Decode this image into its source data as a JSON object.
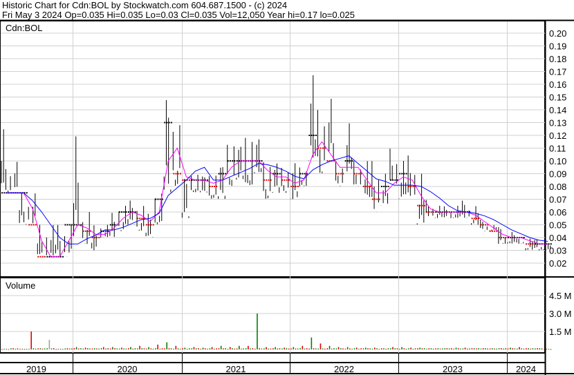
{
  "header": {
    "title": "Historic Chart for Cdn:BOL by Stockwatch.com 604.687.1500 - (c) 2024",
    "quote": "Fri May  3 2024  Op=0.035  Hi=0.035  Lo=0.03  Cl=0.035  Vol=12,050  Year hi=0.17  lo=0.025"
  },
  "chart_data": {
    "type": "line",
    "symbol": "Cdn:BOL",
    "volume_label": "Volume",
    "price_ticks": [
      "0.20",
      "0.19",
      "0.18",
      "0.17",
      "0.16",
      "0.15",
      "0.14",
      "0.13",
      "0.12",
      "0.11",
      "0.10",
      "0.09",
      "0.08",
      "0.07",
      "0.06",
      "0.05",
      "0.04",
      "0.03",
      "0.02"
    ],
    "price_range": [
      0.01,
      0.21
    ],
    "volume_ticks": [
      "4.5 M",
      "3.0 M",
      "1.5 M"
    ],
    "volume_range_m": [
      0,
      5.7
    ],
    "years": [
      "2019",
      "2020",
      "2021",
      "2022",
      "2023",
      "2024"
    ],
    "start_month": "2019-05",
    "high": [
      0.125,
      0.1,
      0.075,
      0.075,
      0.05,
      0.05,
      0.05,
      0.05,
      0.12,
      0.06,
      0.05,
      0.05,
      0.06,
      0.065,
      0.07,
      0.065,
      0.06,
      0.075,
      0.155,
      0.13,
      0.09,
      0.09,
      0.09,
      0.09,
      0.1,
      0.115,
      0.115,
      0.12,
      0.12,
      0.1,
      0.1,
      0.095,
      0.1,
      0.095,
      0.17,
      0.14,
      0.15,
      0.1,
      0.13,
      0.1,
      0.1,
      0.1,
      0.09,
      0.11,
      0.1,
      0.105,
      0.09,
      0.07,
      0.065,
      0.065,
      0.065,
      0.07,
      0.065,
      0.055,
      0.05,
      0.05,
      0.045,
      0.04,
      0.04,
      0.04,
      0.035
    ],
    "low": [
      0.075,
      0.075,
      0.05,
      0.05,
      0.025,
      0.025,
      0.025,
      0.025,
      0.04,
      0.035,
      0.03,
      0.04,
      0.04,
      0.045,
      0.05,
      0.045,
      0.04,
      0.05,
      0.075,
      0.08,
      0.055,
      0.075,
      0.075,
      0.07,
      0.07,
      0.08,
      0.085,
      0.08,
      0.09,
      0.07,
      0.075,
      0.075,
      0.07,
      0.08,
      0.1,
      0.09,
      0.1,
      0.08,
      0.09,
      0.08,
      0.07,
      0.06,
      0.065,
      0.08,
      0.07,
      0.07,
      0.05,
      0.055,
      0.055,
      0.055,
      0.055,
      0.055,
      0.05,
      0.045,
      0.045,
      0.035,
      0.035,
      0.035,
      0.03,
      0.03,
      0.03
    ],
    "close": [
      0.075,
      0.075,
      0.075,
      0.05,
      0.025,
      0.025,
      0.025,
      0.05,
      0.05,
      0.045,
      0.04,
      0.045,
      0.05,
      0.06,
      0.06,
      0.055,
      0.05,
      0.07,
      0.13,
      0.09,
      0.085,
      0.085,
      0.085,
      0.08,
      0.09,
      0.1,
      0.1,
      0.1,
      0.1,
      0.085,
      0.09,
      0.085,
      0.08,
      0.09,
      0.12,
      0.11,
      0.1,
      0.09,
      0.1,
      0.09,
      0.08,
      0.07,
      0.08,
      0.085,
      0.09,
      0.08,
      0.065,
      0.06,
      0.06,
      0.06,
      0.06,
      0.06,
      0.055,
      0.05,
      0.045,
      0.04,
      0.04,
      0.04,
      0.035,
      0.035,
      0.035
    ],
    "volume_m": [
      0.05,
      0.1,
      0.05,
      1.5,
      0.1,
      0.8,
      0.05,
      0.1,
      0.2,
      0.15,
      0.1,
      0.2,
      0.2,
      0.15,
      0.2,
      0.3,
      0.2,
      0.4,
      0.6,
      0.3,
      0.15,
      0.2,
      0.15,
      0.2,
      0.3,
      0.2,
      0.3,
      0.3,
      3.0,
      0.2,
      0.2,
      0.15,
      0.2,
      0.3,
      1.0,
      0.5,
      0.3,
      0.2,
      0.2,
      0.15,
      0.15,
      0.15,
      0.1,
      0.2,
      0.2,
      0.15,
      0.15,
      0.1,
      0.1,
      0.1,
      0.15,
      0.15,
      0.1,
      0.1,
      0.1,
      0.1,
      0.15,
      0.2,
      0.1,
      0.1,
      0.05
    ],
    "series": [
      {
        "name": "short MA",
        "color": "#ff00ff"
      },
      {
        "name": "long MA",
        "color": "#0000ff"
      }
    ]
  }
}
